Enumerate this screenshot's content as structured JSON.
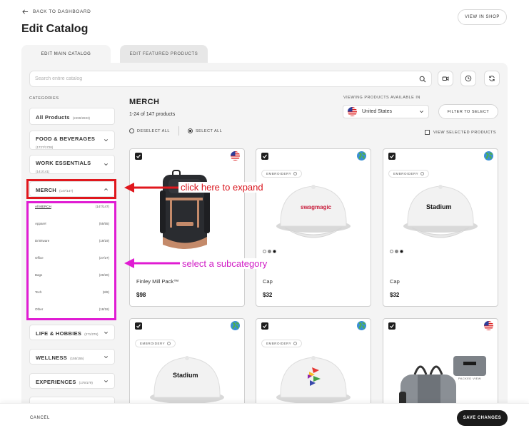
{
  "header": {
    "back_label": "BACK TO DASHBOARD",
    "title": "Edit Catalog",
    "view_shop": "VIEW IN SHOP"
  },
  "tabs": [
    {
      "label": "EDIT MAIN CATALOG",
      "active": true
    },
    {
      "label": "EDIT FEATURED PRODUCTS",
      "active": false
    }
  ],
  "search": {
    "placeholder": "Search entire catalog"
  },
  "toolbar_icons": [
    "video-icon",
    "clock-icon",
    "refresh-icon"
  ],
  "sidebar": {
    "title": "CATEGORIES",
    "categories": [
      {
        "label": "All Products",
        "count": "(2499/2833)"
      },
      {
        "label": "FOOD & BEVERAGES",
        "count": "(1727/1728)"
      },
      {
        "label": "WORK ESSENTIALS",
        "count": "(141/141)"
      },
      {
        "label": "MERCH",
        "count": "(147/147)",
        "expanded": true
      },
      {
        "label": "LIFE & HOBBIES",
        "count": "(271/276)"
      },
      {
        "label": "WELLNESS",
        "count": "(155/155)"
      },
      {
        "label": "EXPERIENCES",
        "count": "(179/179)"
      }
    ],
    "subcategories": [
      {
        "label": "All MERCH",
        "count": "(147/147)",
        "active": true
      },
      {
        "label": "Apparel",
        "count": "(55/55)"
      },
      {
        "label": "Drinkware",
        "count": "(19/19)"
      },
      {
        "label": "Office",
        "count": "(27/27)"
      },
      {
        "label": "Bags",
        "count": "(20/20)"
      },
      {
        "label": "Tech",
        "count": "(8/8)"
      },
      {
        "label": "Other",
        "count": "(18/18)"
      }
    ]
  },
  "main": {
    "title": "MERCH",
    "count_text": "1-24 of 147 products",
    "deselect_all": "DESELECT ALL",
    "select_all": "SELECT ALL",
    "selected_option": "SELECT ALL",
    "viewing_label": "VIEWING PRODUCTS AVAILABLE IN",
    "country": "United States",
    "filter_button": "FILTER TO SELECT",
    "view_selected": "VIEW SELECTED PRODUCTS"
  },
  "products": [
    {
      "name": "Finley Mill Pack™",
      "price": "$98",
      "checked": true,
      "region_icon": "us-flag-icon",
      "tag": "",
      "image": "backpack"
    },
    {
      "name": "Cap",
      "price": "$32",
      "checked": true,
      "region_icon": "globe-icon",
      "tag": "EMBROIDERY",
      "image": "cap-swagmagic",
      "logo_text": "swagmagic"
    },
    {
      "name": "Cap",
      "price": "$32",
      "checked": true,
      "region_icon": "globe-icon",
      "tag": "EMBROIDERY",
      "image": "cap-stadium",
      "logo_text": "Stadium"
    },
    {
      "name": "",
      "price": "",
      "checked": true,
      "region_icon": "globe-icon",
      "tag": "EMBROIDERY",
      "image": "cap-stadium",
      "logo_text": "Stadium"
    },
    {
      "name": "",
      "price": "",
      "checked": true,
      "region_icon": "globe-icon",
      "tag": "EMBROIDERY",
      "image": "cap-logo"
    },
    {
      "name": "",
      "price": "",
      "checked": true,
      "region_icon": "us-flag-icon",
      "tag": "",
      "image": "duffel-bag",
      "image_caption": "PACKED VIEW"
    }
  ],
  "annotations": {
    "expand": "click here to expand",
    "subcategory": "select a subcategory"
  },
  "footer": {
    "cancel": "CANCEL",
    "save": "SAVE CHANGES"
  },
  "colors": {
    "annotation_red": "#e0171d",
    "annotation_magenta": "#e01cd3",
    "primary_dark": "#1b1b1b",
    "panel_bg": "#f4f4f4"
  }
}
